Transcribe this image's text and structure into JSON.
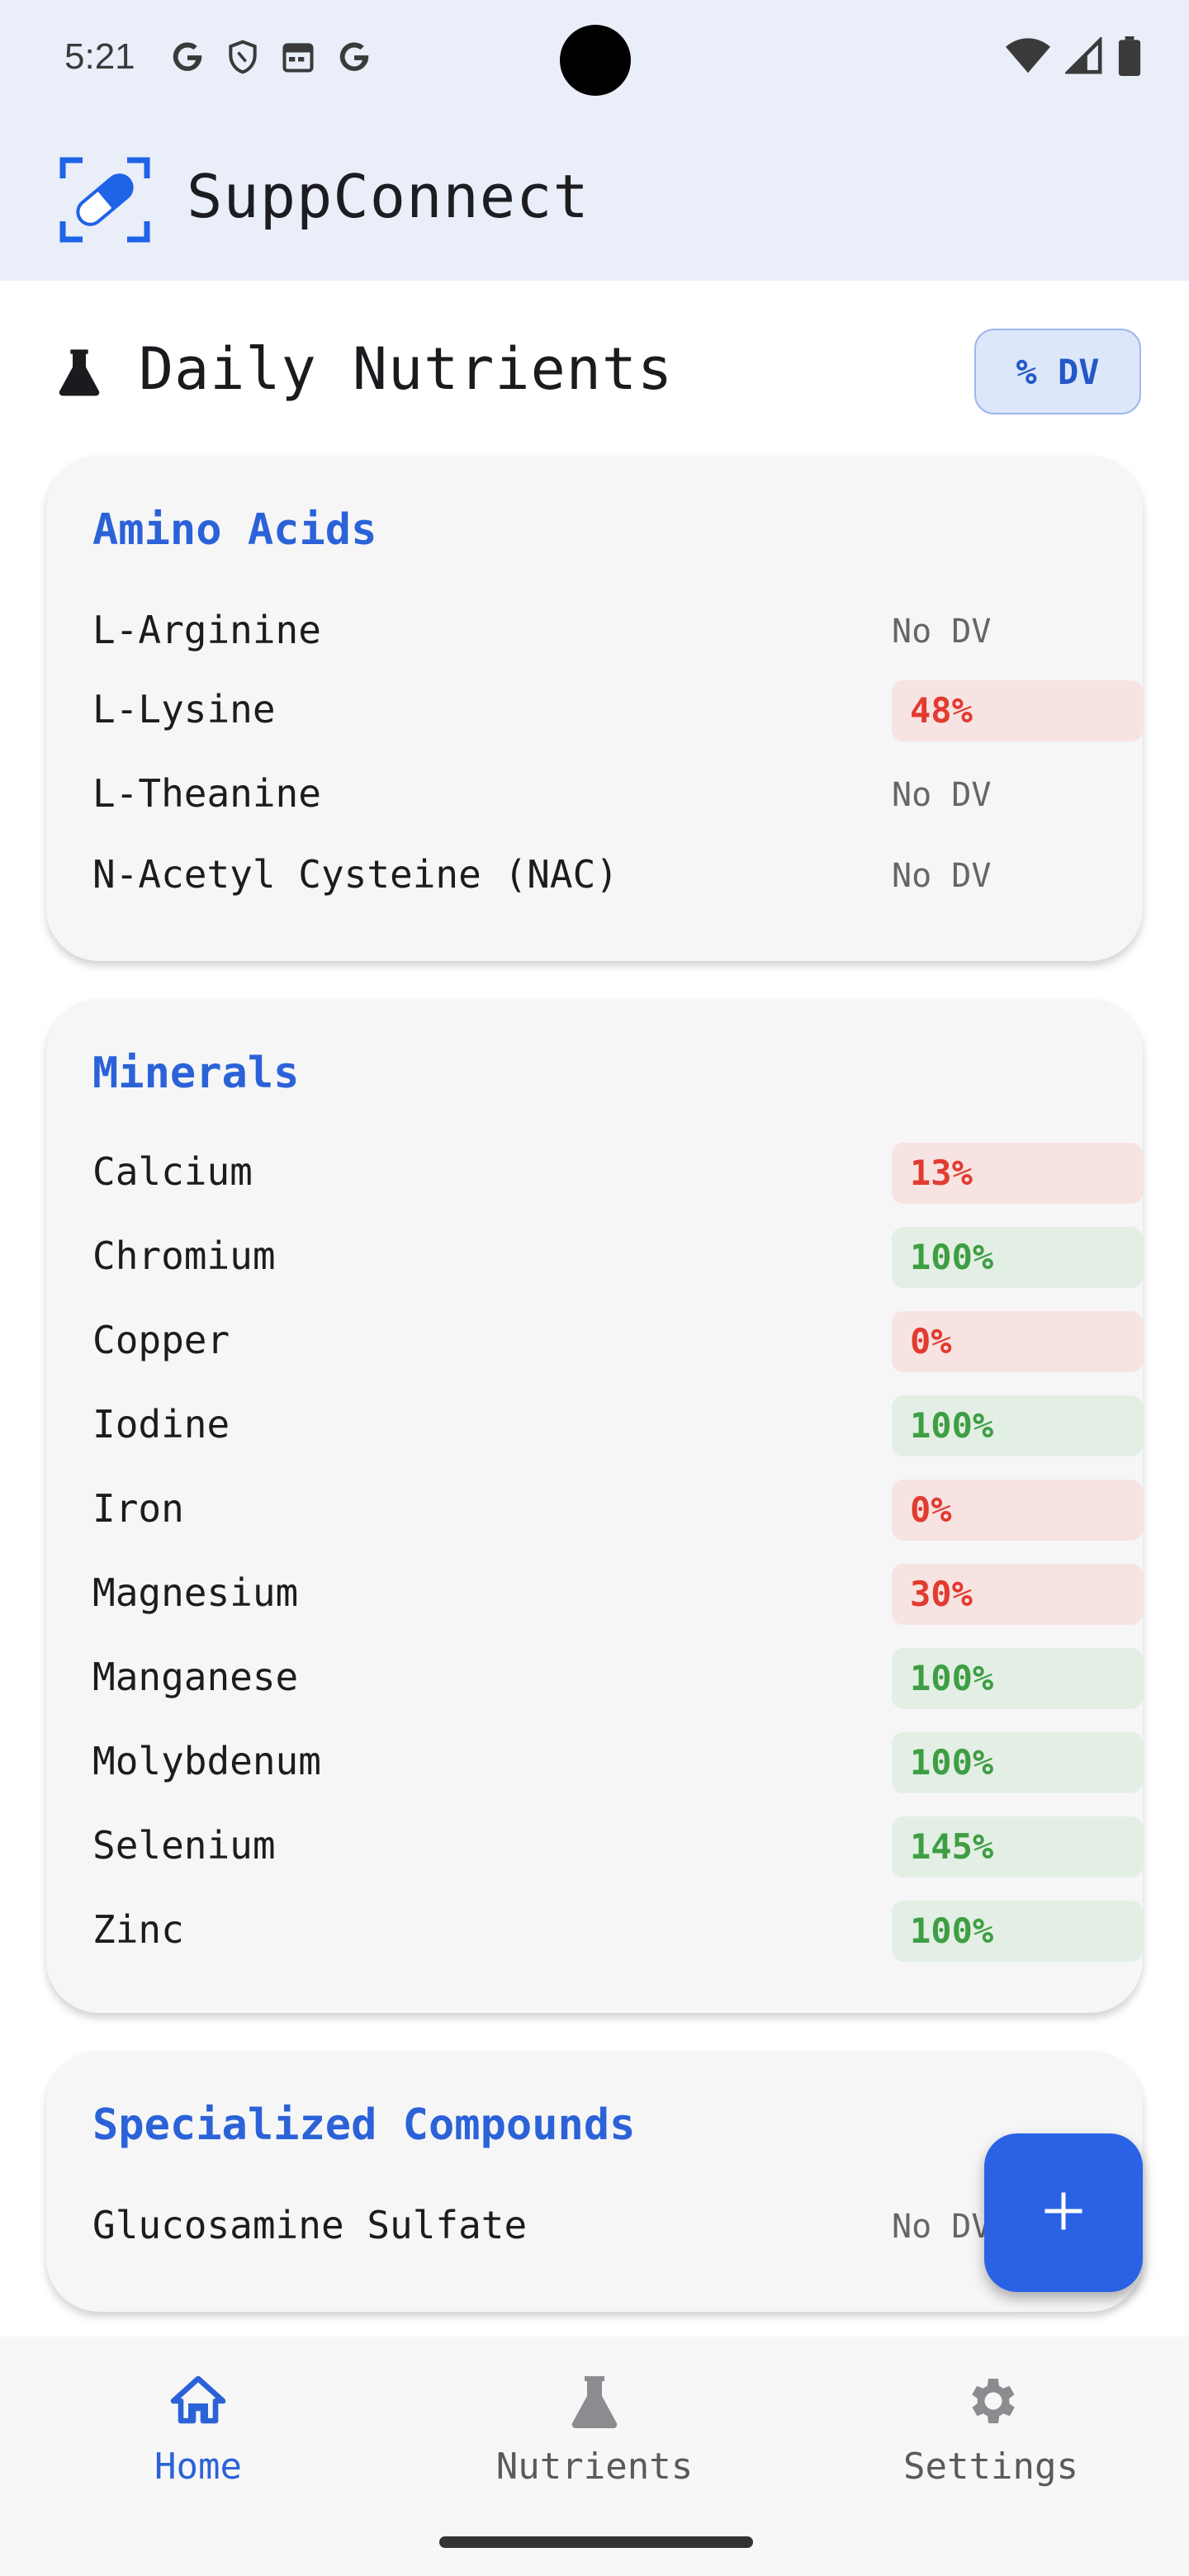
{
  "status_bar": {
    "time": "5:21"
  },
  "app": {
    "title": "SuppConnect"
  },
  "header": {
    "title": "Daily Nutrients",
    "dv_toggle_label": "% DV"
  },
  "sections": [
    {
      "title": "Amino Acids",
      "items": [
        {
          "name": "L-Arginine",
          "dv": "No DV",
          "status": "nodv"
        },
        {
          "name": "L-Lysine",
          "dv": "48%",
          "status": "low"
        },
        {
          "name": "L-Theanine",
          "dv": "No DV",
          "status": "nodv"
        },
        {
          "name": "N-Acetyl Cysteine (NAC)",
          "dv": "No DV",
          "status": "nodv"
        }
      ]
    },
    {
      "title": "Minerals",
      "items": [
        {
          "name": "Calcium",
          "dv": "13%",
          "status": "low"
        },
        {
          "name": "Chromium",
          "dv": "100%",
          "status": "good"
        },
        {
          "name": "Copper",
          "dv": "0%",
          "status": "low"
        },
        {
          "name": "Iodine",
          "dv": "100%",
          "status": "good"
        },
        {
          "name": "Iron",
          "dv": "0%",
          "status": "low"
        },
        {
          "name": "Magnesium",
          "dv": "30%",
          "status": "low"
        },
        {
          "name": "Manganese",
          "dv": "100%",
          "status": "good"
        },
        {
          "name": "Molybdenum",
          "dv": "100%",
          "status": "good"
        },
        {
          "name": "Selenium",
          "dv": "145%",
          "status": "good"
        },
        {
          "name": "Zinc",
          "dv": "100%",
          "status": "good"
        }
      ]
    },
    {
      "title": "Specialized Compounds",
      "items": [
        {
          "name": "Glucosamine Sulfate",
          "dv": "No DV",
          "status": "nodv"
        }
      ]
    }
  ],
  "fab": {
    "icon": "plus-icon"
  },
  "bottom_nav": [
    {
      "label": "Home",
      "icon": "home-icon",
      "active": true
    },
    {
      "label": "Nutrients",
      "icon": "flask-icon",
      "active": false
    },
    {
      "label": "Settings",
      "icon": "gear-icon",
      "active": false
    }
  ],
  "colors": {
    "accent": "#2b62d8",
    "low_text": "#e23b30",
    "low_bg": "#f7e3e2",
    "good_text": "#3e9e44",
    "good_bg": "#e3efe4"
  }
}
